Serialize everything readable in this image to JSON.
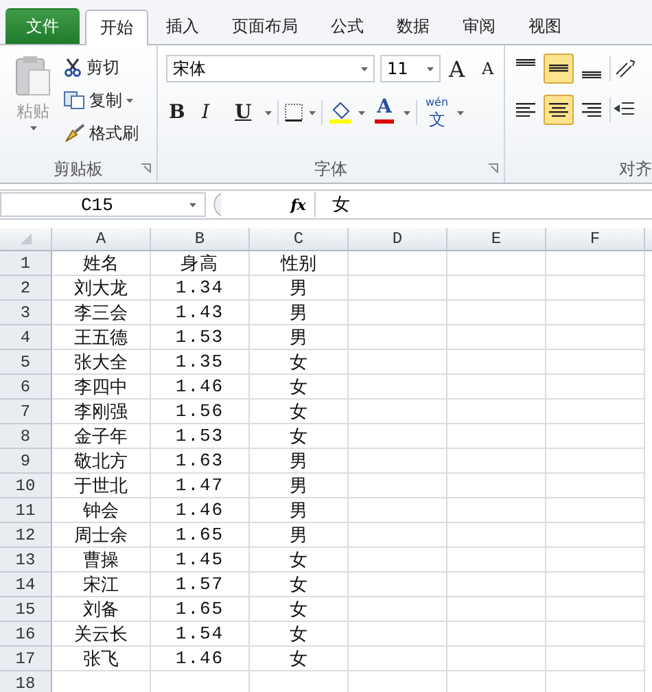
{
  "tabs": [
    {
      "label": "文件",
      "kind": "file",
      "selected": false
    },
    {
      "label": "开始",
      "kind": "tab",
      "selected": true
    },
    {
      "label": "插入",
      "kind": "tab",
      "selected": false
    },
    {
      "label": "页面布局",
      "kind": "tab",
      "selected": false
    },
    {
      "label": "公式",
      "kind": "tab",
      "selected": false
    },
    {
      "label": "数据",
      "kind": "tab",
      "selected": false
    },
    {
      "label": "审阅",
      "kind": "tab",
      "selected": false
    },
    {
      "label": "视图",
      "kind": "tab",
      "selected": false
    }
  ],
  "clipboard": {
    "paste": "粘贴",
    "cut": "剪切",
    "copy": "复制",
    "format_painter": "格式刷",
    "label": "剪贴板"
  },
  "font": {
    "name": "宋体",
    "size": "11",
    "grow": "A",
    "shrink": "A",
    "bold": "B",
    "italic": "I",
    "underline": "U",
    "font_color": "A",
    "phonetic_top": "wén",
    "phonetic": "文",
    "label": "字体"
  },
  "alignment": {
    "label": "对齐",
    "top_row": [
      {
        "kind": "top",
        "selected": false
      },
      {
        "kind": "middle",
        "selected": true
      },
      {
        "kind": "bottom",
        "selected": false
      }
    ],
    "bottom_row": [
      {
        "kind": "left",
        "selected": false
      },
      {
        "kind": "center",
        "selected": true
      },
      {
        "kind": "right",
        "selected": false
      }
    ]
  },
  "formula_bar": {
    "name_box": "C15",
    "fx": "fx",
    "formula": "女"
  },
  "columns": [
    "A",
    "B",
    "C",
    "D",
    "E",
    "F"
  ],
  "rows": [
    {
      "number": "1",
      "cells": [
        "姓名",
        "身高",
        "性别"
      ]
    },
    {
      "number": "2",
      "cells": [
        "刘大龙",
        "1.34",
        "男"
      ]
    },
    {
      "number": "3",
      "cells": [
        "李三会",
        "1.43",
        "男"
      ]
    },
    {
      "number": "4",
      "cells": [
        "王五德",
        "1.53",
        "男"
      ]
    },
    {
      "number": "5",
      "cells": [
        "张大全",
        "1.35",
        "女"
      ]
    },
    {
      "number": "6",
      "cells": [
        "李四中",
        "1.46",
        "女"
      ]
    },
    {
      "number": "7",
      "cells": [
        "李刚强",
        "1.56",
        "女"
      ]
    },
    {
      "number": "8",
      "cells": [
        "金子年",
        "1.53",
        "女"
      ]
    },
    {
      "number": "9",
      "cells": [
        "敬北方",
        "1.63",
        "男"
      ]
    },
    {
      "number": "10",
      "cells": [
        "于世北",
        "1.47",
        "男"
      ]
    },
    {
      "number": "11",
      "cells": [
        "钟会",
        "1.46",
        "男"
      ]
    },
    {
      "number": "12",
      "cells": [
        "周士余",
        "1.65",
        "男"
      ]
    },
    {
      "number": "13",
      "cells": [
        "曹操",
        "1.45",
        "女"
      ]
    },
    {
      "number": "14",
      "cells": [
        "宋江",
        "1.57",
        "女"
      ]
    },
    {
      "number": "15",
      "cells": [
        "刘备",
        "1.65",
        "女"
      ]
    },
    {
      "number": "16",
      "cells": [
        "关云长",
        "1.54",
        "女"
      ]
    },
    {
      "number": "17",
      "cells": [
        "张飞",
        "1.46",
        "女"
      ]
    },
    {
      "number": "18",
      "cells": []
    }
  ]
}
